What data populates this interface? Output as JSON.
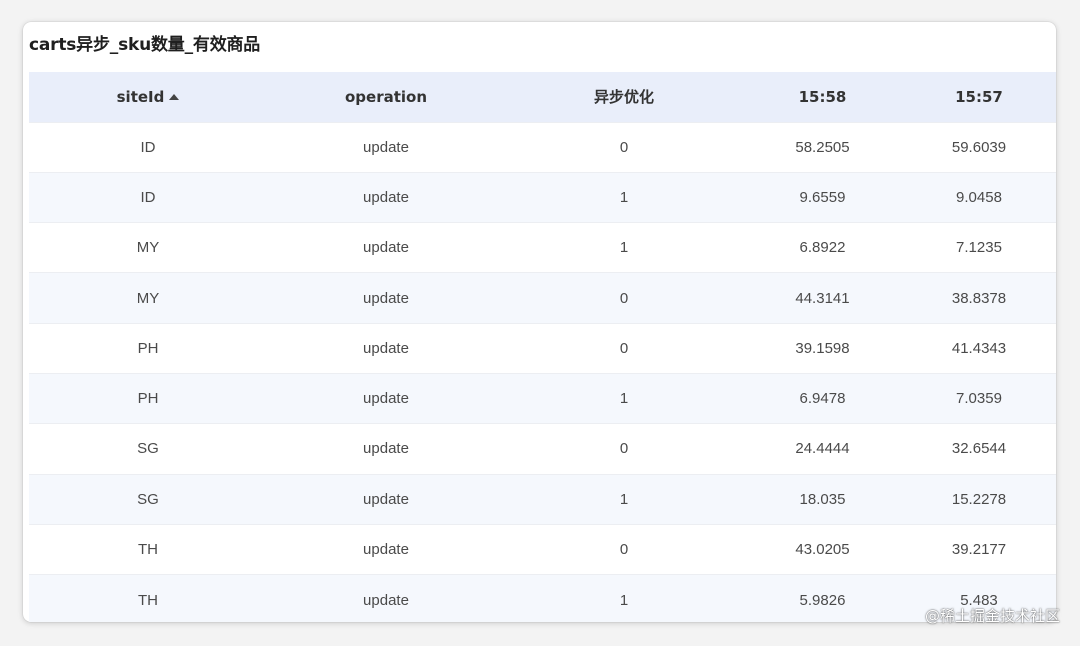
{
  "title": "carts异步_sku数量_有效商品",
  "table": {
    "columns": [
      "siteId",
      "operation",
      "异步优化",
      "15:58",
      "15:57"
    ],
    "sort": {
      "column": "siteId",
      "direction": "ascending"
    },
    "rows": [
      [
        "ID",
        "update",
        "0",
        "58.2505",
        "59.6039"
      ],
      [
        "ID",
        "update",
        "1",
        "9.6559",
        "9.0458"
      ],
      [
        "MY",
        "update",
        "1",
        "6.8922",
        "7.1235"
      ],
      [
        "MY",
        "update",
        "0",
        "44.3141",
        "38.8378"
      ],
      [
        "PH",
        "update",
        "0",
        "39.1598",
        "41.4343"
      ],
      [
        "PH",
        "update",
        "1",
        "6.9478",
        "7.0359"
      ],
      [
        "SG",
        "update",
        "0",
        "24.4444",
        "32.6544"
      ],
      [
        "SG",
        "update",
        "1",
        "18.035",
        "15.2278"
      ],
      [
        "TH",
        "update",
        "0",
        "43.0205",
        "39.2177"
      ],
      [
        "TH",
        "update",
        "1",
        "5.9826",
        "5.483"
      ]
    ]
  },
  "watermark": "@稀土掘金技术社区",
  "colors": {
    "header_background": "#e9eefa",
    "stripe_background": "#f5f8fd"
  }
}
